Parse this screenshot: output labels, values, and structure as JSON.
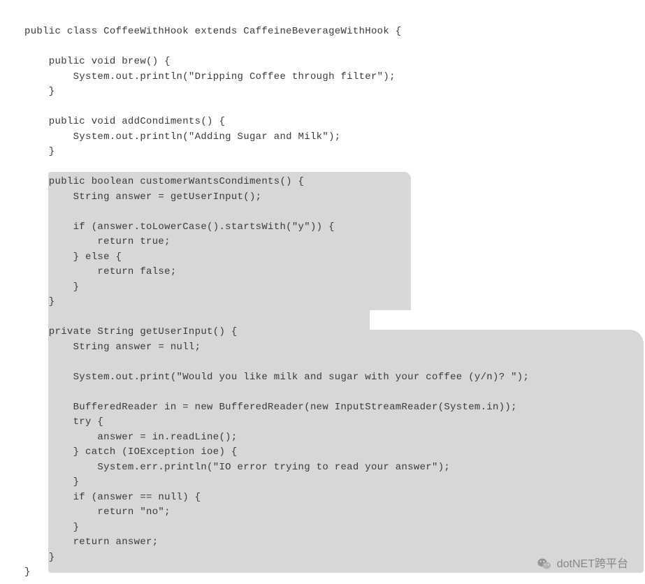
{
  "code": {
    "lines": [
      "public class CoffeeWithHook extends CaffeineBeverageWithHook {",
      "",
      "    public void brew() {",
      "        System.out.println(\"Dripping Coffee through filter\");",
      "    }",
      "",
      "    public void addCondiments() {",
      "        System.out.println(\"Adding Sugar and Milk\");",
      "    }",
      "",
      "    public boolean customerWantsCondiments() {",
      "        String answer = getUserInput();",
      "",
      "        if (answer.toLowerCase().startsWith(\"y\")) {",
      "            return true;",
      "        } else {",
      "            return false;",
      "        }",
      "    }",
      "",
      "    private String getUserInput() {",
      "        String answer = null;",
      "",
      "        System.out.print(\"Would you like milk and sugar with your coffee (y/n)? \");",
      "",
      "        BufferedReader in = new BufferedReader(new InputStreamReader(System.in));",
      "        try {",
      "            answer = in.readLine();",
      "        } catch (IOException ioe) {",
      "            System.err.println(\"IO error trying to read your answer\");",
      "        }",
      "        if (answer == null) {",
      "            return \"no\";",
      "        }",
      "        return answer;",
      "    }",
      "}"
    ]
  },
  "watermark": {
    "text": "dotNET跨平台"
  }
}
